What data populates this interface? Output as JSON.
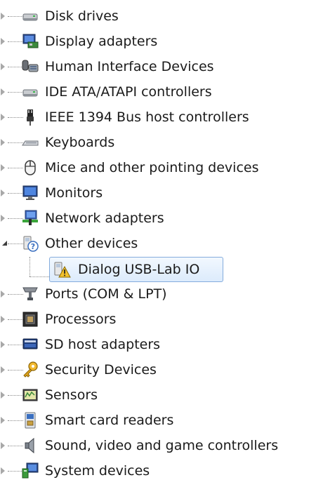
{
  "tree": {
    "items": [
      {
        "label": "Disk drives",
        "icon": "disk-drive-icon"
      },
      {
        "label": "Display adapters",
        "icon": "display-adapter-icon"
      },
      {
        "label": "Human Interface Devices",
        "icon": "hid-icon"
      },
      {
        "label": "IDE ATA/ATAPI controllers",
        "icon": "ide-controller-icon"
      },
      {
        "label": "IEEE 1394 Bus host controllers",
        "icon": "firewire-icon"
      },
      {
        "label": "Keyboards",
        "icon": "keyboard-icon"
      },
      {
        "label": "Mice and other pointing devices",
        "icon": "mouse-icon"
      },
      {
        "label": "Monitors",
        "icon": "monitor-icon"
      },
      {
        "label": "Network adapters",
        "icon": "network-adapter-icon"
      },
      {
        "label": "Other devices",
        "icon": "other-devices-icon",
        "expanded": true
      },
      {
        "label": "Ports (COM & LPT)",
        "icon": "ports-icon"
      },
      {
        "label": "Processors",
        "icon": "processor-icon"
      },
      {
        "label": "SD host adapters",
        "icon": "sd-adapter-icon"
      },
      {
        "label": "Security Devices",
        "icon": "security-key-icon"
      },
      {
        "label": "Sensors",
        "icon": "sensor-icon"
      },
      {
        "label": "Smart card readers",
        "icon": "smart-card-icon"
      },
      {
        "label": "Sound, video and game controllers",
        "icon": "speaker-icon"
      },
      {
        "label": "System devices",
        "icon": "system-devices-icon"
      }
    ],
    "child": {
      "label": "Dialog USB-Lab IO",
      "icon": "warning-device-icon",
      "selected": true
    }
  },
  "colors": {
    "selection_border": "#84acdd",
    "selection_fill": "#dcebfc",
    "warning": "#f2c12e"
  }
}
